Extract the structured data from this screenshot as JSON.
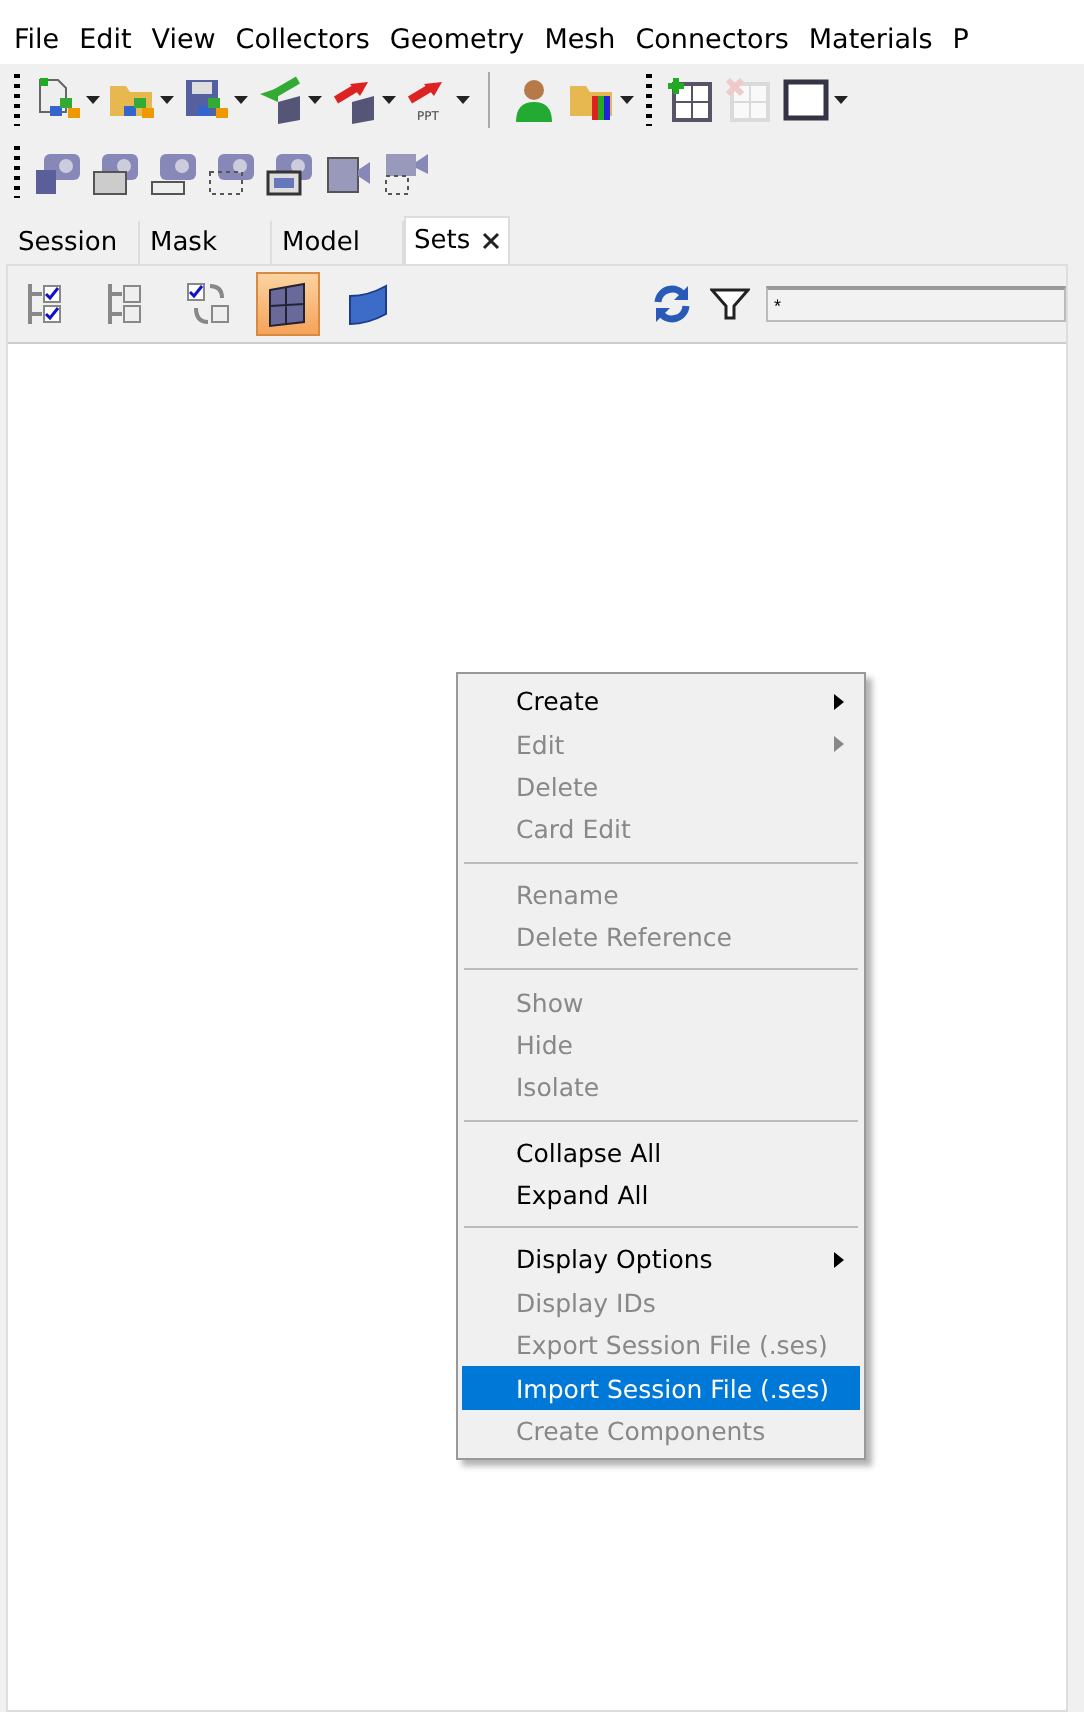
{
  "menu_bar": [
    "File",
    "Edit",
    "View",
    "Collectors",
    "Geometry",
    "Mesh",
    "Connectors",
    "Materials",
    "P"
  ],
  "toolbar_1": [
    {
      "kind": "new-model",
      "dropdown": true
    },
    {
      "kind": "open-model",
      "dropdown": true
    },
    {
      "kind": "save-model",
      "dropdown": true
    },
    {
      "kind": "import",
      "dropdown": true
    },
    {
      "kind": "export",
      "dropdown": true
    },
    {
      "kind": "export-ppt",
      "label": "PPT",
      "dropdown": true
    },
    {
      "kind": "separator"
    },
    {
      "kind": "user",
      "dropdown": false
    },
    {
      "kind": "results",
      "dropdown": true
    },
    {
      "kind": "grip"
    },
    {
      "kind": "add-page",
      "dropdown": false
    },
    {
      "kind": "delete-page",
      "dropdown": false,
      "disabled": true
    },
    {
      "kind": "layout",
      "dropdown": true
    }
  ],
  "toolbar_2": [
    {
      "kind": "save"
    },
    {
      "kind": "window"
    },
    {
      "kind": "field"
    },
    {
      "kind": "dashed"
    },
    {
      "kind": "framed"
    },
    {
      "kind": "video"
    },
    {
      "kind": "video-dashed"
    }
  ],
  "tabs": [
    {
      "label": "Session",
      "selected": false,
      "closable": false
    },
    {
      "label": "Mask",
      "selected": false,
      "closable": false
    },
    {
      "label": "Model",
      "selected": false,
      "closable": false
    },
    {
      "label": "Sets",
      "selected": true,
      "closable": true
    }
  ],
  "panel_toolbar": [
    {
      "kind": "check-all",
      "selected": false
    },
    {
      "kind": "uncheck-all",
      "selected": false
    },
    {
      "kind": "swap",
      "selected": false
    },
    {
      "kind": "grid",
      "selected": true
    },
    {
      "kind": "surface",
      "selected": false
    }
  ],
  "filter": {
    "value": "*"
  },
  "context_menu": [
    {
      "kind": "item",
      "label": "Create",
      "disabled": false,
      "submenu": true,
      "selected": false
    },
    {
      "kind": "item",
      "label": "Edit",
      "disabled": true,
      "submenu": true,
      "selected": false
    },
    {
      "kind": "item",
      "label": "Delete",
      "disabled": true,
      "submenu": false,
      "selected": false
    },
    {
      "kind": "item",
      "label": "Card Edit",
      "disabled": true,
      "submenu": false,
      "selected": false
    },
    {
      "kind": "separator"
    },
    {
      "kind": "item",
      "label": "Rename",
      "disabled": true,
      "submenu": false,
      "selected": false
    },
    {
      "kind": "item",
      "label": "Delete Reference",
      "disabled": true,
      "submenu": false,
      "selected": false
    },
    {
      "kind": "separator"
    },
    {
      "kind": "item",
      "label": "Show",
      "disabled": true,
      "submenu": false,
      "selected": false
    },
    {
      "kind": "item",
      "label": "Hide",
      "disabled": true,
      "submenu": false,
      "selected": false
    },
    {
      "kind": "item",
      "label": "Isolate",
      "disabled": true,
      "submenu": false,
      "selected": false
    },
    {
      "kind": "separator"
    },
    {
      "kind": "item",
      "label": "Collapse All",
      "disabled": false,
      "submenu": false,
      "selected": false
    },
    {
      "kind": "item",
      "label": "Expand All",
      "disabled": false,
      "submenu": false,
      "selected": false
    },
    {
      "kind": "separator"
    },
    {
      "kind": "item",
      "label": "Display Options",
      "disabled": false,
      "submenu": true,
      "selected": false
    },
    {
      "kind": "item",
      "label": "Display IDs",
      "disabled": true,
      "submenu": false,
      "selected": false
    },
    {
      "kind": "item",
      "label": "Export Session File (.ses)",
      "disabled": true,
      "submenu": false,
      "selected": false
    },
    {
      "kind": "item",
      "label": "Import Session File (.ses)",
      "disabled": false,
      "submenu": false,
      "selected": true
    },
    {
      "kind": "item",
      "label": "Create Components",
      "disabled": true,
      "submenu": false,
      "selected": false
    }
  ]
}
